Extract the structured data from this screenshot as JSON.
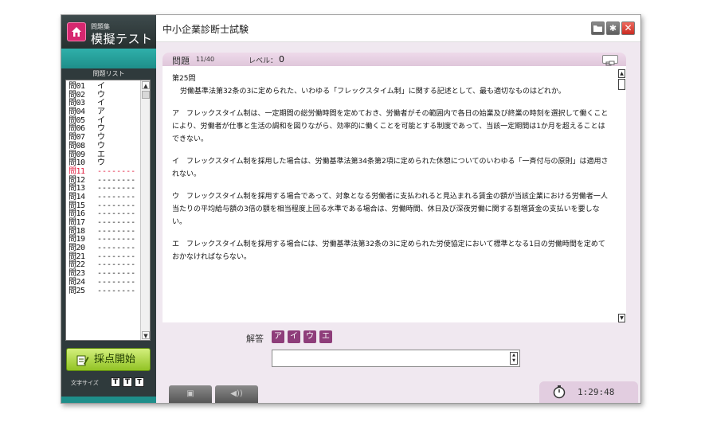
{
  "app": {
    "logo_sub": "問題集",
    "logo_title": "模擬テスト",
    "window_title": "中小企業診断士試験"
  },
  "sidebar": {
    "list_header": "問題リスト",
    "questions": [
      {
        "num": "問01",
        "answer": "イ"
      },
      {
        "num": "問02",
        "answer": "ウ"
      },
      {
        "num": "問03",
        "answer": "イ"
      },
      {
        "num": "問04",
        "answer": "ア"
      },
      {
        "num": "問05",
        "answer": "イ"
      },
      {
        "num": "問06",
        "answer": "ウ"
      },
      {
        "num": "問07",
        "answer": "ウ"
      },
      {
        "num": "問08",
        "answer": "ウ"
      },
      {
        "num": "問09",
        "answer": "エ"
      },
      {
        "num": "問10",
        "answer": "ウ"
      },
      {
        "num": "問11",
        "answer": "--------",
        "current": true
      },
      {
        "num": "問12",
        "answer": "--------"
      },
      {
        "num": "問13",
        "answer": "--------"
      },
      {
        "num": "問14",
        "answer": "--------"
      },
      {
        "num": "問15",
        "answer": "--------"
      },
      {
        "num": "問16",
        "answer": "--------"
      },
      {
        "num": "問17",
        "answer": "--------"
      },
      {
        "num": "問18",
        "answer": "--------"
      },
      {
        "num": "問19",
        "answer": "--------"
      },
      {
        "num": "問20",
        "answer": "--------"
      },
      {
        "num": "問21",
        "answer": "--------"
      },
      {
        "num": "問22",
        "answer": "--------"
      },
      {
        "num": "問23",
        "answer": "--------"
      },
      {
        "num": "問24",
        "answer": "--------"
      },
      {
        "num": "問25",
        "answer": "--------"
      }
    ],
    "grade_button": "採点開始",
    "font_size_label": "文字サイズ",
    "font_size_options": [
      "T",
      "T",
      "T"
    ]
  },
  "question": {
    "label": "問題",
    "count": "11/40",
    "level_label": "レベル：",
    "level_value": "0",
    "number": "第25問",
    "stem": "労働基準法第32条の3に定められた、いわゆる「フレックスタイム制」に関する記述として、最も適切なものはどれか。",
    "options": [
      "ア　フレックスタイム制は、一定期間の総労働時間を定めておき、労働者がその範囲内で各日の始業及び終業の時刻を選択して働くことにより、労働者が仕事と生活の調和を図りながら、効率的に働くことを可能とする制度であって、当該一定期間は1か月を超えることはできない。",
      "イ　フレックスタイム制を採用した場合は、労働基準法第34条第2項に定められた休憩についてのいわゆる「一斉付与の原則」は適用されない。",
      "ウ　フレックスタイム制を採用する場合であって、対象となる労働者に支払われると見込まれる賃金の額が当該企業における労働者一人当たりの平均給与額の3倍の額を相当程度上回る水準である場合は、労働時間、休日及び深夜労働に関する割増賃金の支払いを要しない。",
      "エ　フレックスタイム制を採用する場合には、労働基準法第32条の3に定められた労使協定において標準となる1日の労働時間を定めておかなければならない。"
    ]
  },
  "answer": {
    "label": "解答",
    "choices": [
      "ア",
      "イ",
      "ウ",
      "エ"
    ],
    "value": ""
  },
  "timer": {
    "value": "1:29:48"
  },
  "colors": {
    "sidebar_bg": "#2f3a3c",
    "teal": "#1e8e8a",
    "accent_purple": "#8e3d7a",
    "current_red": "#e0193a",
    "grade_green": "#92c325",
    "close_red": "#c92c22"
  },
  "icons": [
    "home-icon",
    "folder-icon",
    "gear-icon",
    "close-icon",
    "expand-icon",
    "memo-icon",
    "stopwatch-icon",
    "image-icon",
    "sound-icon"
  ]
}
